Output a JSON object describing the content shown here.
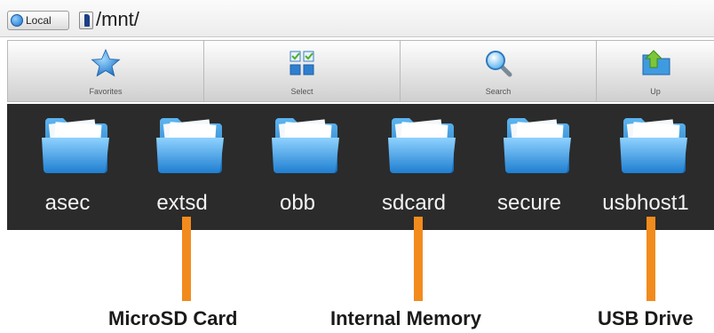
{
  "pathbar": {
    "location_button": "Local",
    "path": "/mnt/"
  },
  "toolbar": {
    "buttons": [
      {
        "label": "Favorites",
        "icon": "star-icon"
      },
      {
        "label": "Select",
        "icon": "select-grid-icon"
      },
      {
        "label": "Search",
        "icon": "magnifier-icon"
      },
      {
        "label": "Up",
        "icon": "folder-up-icon"
      }
    ]
  },
  "files": [
    {
      "name": "asec",
      "icon": "folder-icon"
    },
    {
      "name": "extsd",
      "icon": "folder-icon"
    },
    {
      "name": "obb",
      "icon": "folder-icon"
    },
    {
      "name": "sdcard",
      "icon": "folder-icon"
    },
    {
      "name": "secure",
      "icon": "folder-icon"
    },
    {
      "name": "usbhost1",
      "icon": "folder-icon"
    }
  ],
  "annotations": [
    {
      "label": "MicroSD Card",
      "target": "extsd"
    },
    {
      "label": "Internal Memory",
      "target": "sdcard"
    },
    {
      "label": "USB Drive",
      "target": "usbhost1"
    }
  ],
  "colors": {
    "grid_background": "#2b2b2b",
    "annotation_orange": "#f28b1d",
    "folder_blue": "#4fa9e8"
  }
}
